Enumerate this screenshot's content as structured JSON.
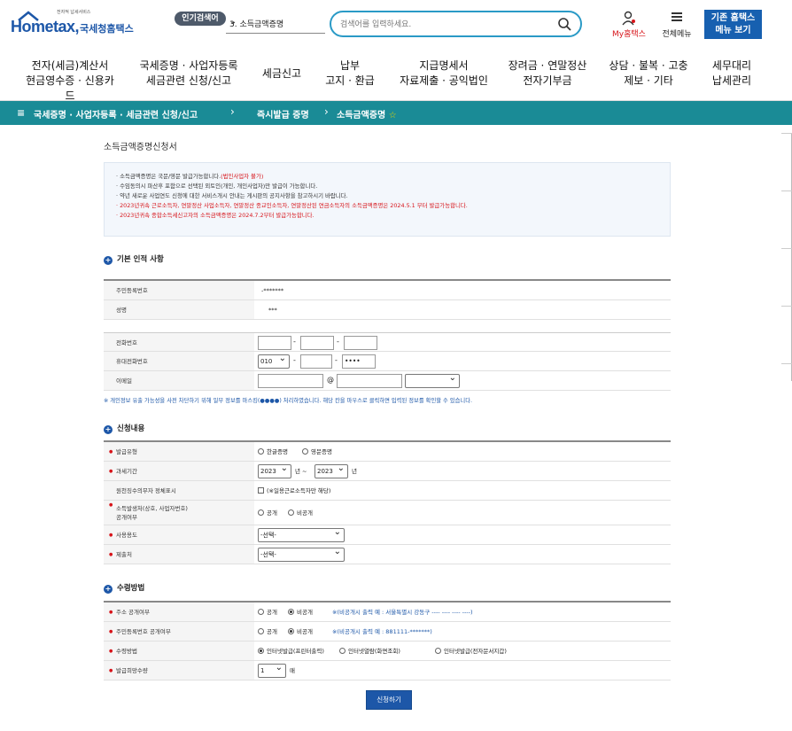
{
  "header": {
    "logo_small": "전자적 납세서비스",
    "logo_main": "Hometax,",
    "logo_sub": "국세청홈택스",
    "popular_badge": "인기검색어",
    "popular_keyword": "3. 소득금액증명",
    "search_placeholder": "검색어를 입력하세요.",
    "myhome_label": "My홈택스",
    "allmenu_label": "전체메뉴",
    "oldmenu_line1": "기존 홈택스",
    "oldmenu_line2": "메뉴 보기"
  },
  "gnb": [
    {
      "l1": "전자(세금)계산서",
      "l2": "현금영수증 · 신용카드"
    },
    {
      "l1": "국세증명 · 사업자등록",
      "l2": "세금관련 신청/신고"
    },
    {
      "l1": "세금신고",
      "l2": ""
    },
    {
      "l1": "납부",
      "l2": "고지 · 환급"
    },
    {
      "l1": "지급명세서",
      "l2": "자료제출 · 공익법인"
    },
    {
      "l1": "장려금 · 연말정산",
      "l2": "전자기부금"
    },
    {
      "l1": "상담 · 불복 · 고충",
      "l2": "제보 · 기타"
    },
    {
      "l1": "세무대리",
      "l2": "납세관리"
    }
  ],
  "breadcrumb": {
    "root": "국세증명 · 사업자등록 · 세금관련 신청/신고",
    "mid": "즉시발급 증명",
    "current": "소득금액증명"
  },
  "page_title": "소득금액증명신청서",
  "notice": [
    {
      "text": "· 소득금액증명은 국문/영문 발급가능합니다.",
      "red": "(법인사업자 불가)"
    },
    {
      "text": "· 수임동의시 파산후 포함으로 선택된 외토인(개인, 개인사업자)만 발급이 가능합니다.",
      "red": ""
    },
    {
      "text": "· 약년 새로운 사업연도 신청에 대한 서비스개시 안내는 게시판의 공지사항을 참고하시기 바랍니다.",
      "red": ""
    },
    {
      "text": "",
      "red": "· 2023년귀속 근로소득자, 연말정산 사업소득자, 연말정산 종교인소득자, 연말정산된 연금소득자의 소득금액증명은 2024.5.1 부터 발급가능합니다."
    },
    {
      "text": "",
      "red": "· 2023년귀속 종합소득세신고자의 소득금액증명은 2024.7.2부터 발급가능합니다."
    }
  ],
  "sections": {
    "basic": "기본 인적 사항",
    "apply": "신청내용",
    "receive": "수령방법"
  },
  "basic": {
    "rrn_label": "주민등록번호",
    "rrn_value": "-*******",
    "name_label": "성명",
    "name_value": "***",
    "phone_label": "전화번호",
    "mobile_label": "휴대전화번호",
    "mobile_prefix": "010",
    "mobile_last": "••••",
    "email_label": "이메일",
    "email_at": "@"
  },
  "privacy_note": "※ 개인정보 유출 가능성을 사전 차단하기 위해 일부 정보를 마스킹(●●●●) 처리하였습니다. 해당 칸을 마우스로 클릭하면 입력된 정보를 확인할 수 있습니다.",
  "apply": {
    "type_label": "발급유형",
    "type_opt1": "한글증명",
    "type_opt2": "영문증명",
    "period_label": "과세기간",
    "year_from": "2023",
    "year_to": "2023",
    "year_unit1": "년 ~",
    "year_unit2": "년",
    "relation_label": "원천징수의무자 정체표시",
    "relation_opt": "(※일용근로소득자만 해당)",
    "disclose_label1": "소득발생처(상호, 사업자번호)",
    "disclose_label2": "공개여부",
    "disclose_opt1": "공개",
    "disclose_opt2": "비공개",
    "use_label": "사용용도",
    "use_value": "-선택-",
    "submit_label": "제출처",
    "submit_value": "-선택-"
  },
  "receive": {
    "addr_label": "주소 공개여부",
    "addr_opt1": "공개",
    "addr_opt2": "비공개",
    "addr_note": "※(비공개시 출력 예 : 서울특별시 강동구 ---- ---- ---- ----)",
    "rrn_label": "주민등록번호 공개여부",
    "rrn_opt1": "공개",
    "rrn_opt2": "비공개",
    "rrn_note": "※(비공개시 출력 예 : 881111-*******)",
    "method_label": "수령방법",
    "method_opt1": "인터넷발급(프린터출력)",
    "method_opt2": "인터넷열람(화면조회)",
    "method_opt3": "인터넷발급(전자문서지갑)",
    "count_label": "발급희망수량",
    "count_value": "1",
    "count_unit": "매"
  },
  "submit_button": "신청하기",
  "colors": {
    "brand": "#1d57a8",
    "teal": "#1a8b96",
    "red": "#d7141a"
  }
}
